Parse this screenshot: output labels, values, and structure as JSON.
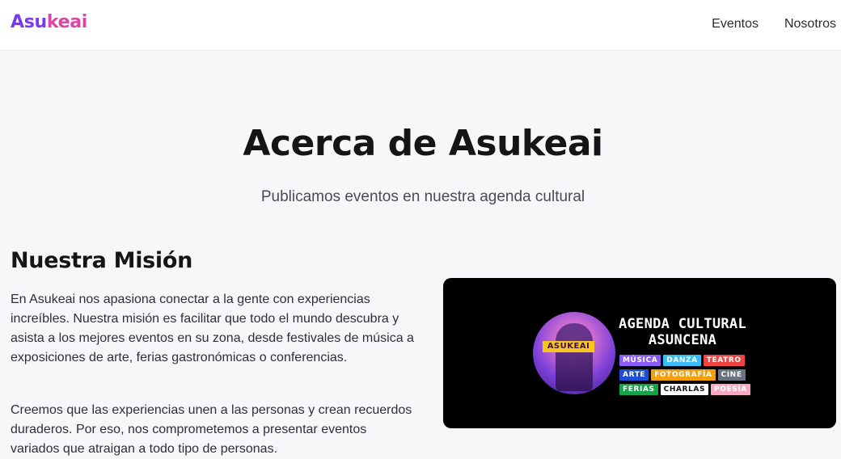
{
  "header": {
    "brand_part1": "Asu",
    "brand_part2": "keai",
    "nav": [
      {
        "label": "Eventos"
      },
      {
        "label": "Nosotros"
      }
    ]
  },
  "hero": {
    "title": "Acerca de Asukeai",
    "subtitle": "Publicamos eventos en nuestra agenda cultural"
  },
  "mission": {
    "title": "Nuestra Misión",
    "paragraph1": "En Asukeai nos apasiona conectar a la gente con experiencias increíbles. Nuestra misión es facilitar que todo el mundo descubra y asista a los mejores eventos en su zona, desde festivales de música a exposiciones de arte, ferias gastronómicas o conferencias.",
    "paragraph2": "Creemos que las experiencias unen a las personas y crean recuerdos duraderos. Por eso, nos comprometemos a presentar eventos variados que atraigan a todo tipo de personas."
  },
  "banner": {
    "logo_tag": "ASUKEAI",
    "title": "AGENDA CULTURAL ASUNCENA",
    "chips": [
      {
        "label": "MÚSICA",
        "bg": "#8b5cf6",
        "fg": "#ffffff"
      },
      {
        "label": "DANZA",
        "bg": "#38bdf8",
        "fg": "#ffffff"
      },
      {
        "label": "TEATRO",
        "bg": "#ef4444",
        "fg": "#ffffff"
      },
      {
        "label": "ARTE",
        "bg": "#1d4ed8",
        "fg": "#ffffff"
      },
      {
        "label": "FOTOGRAFÍA",
        "bg": "#f59e0b",
        "fg": "#ffffff"
      },
      {
        "label": "CINE",
        "bg": "#6b7280",
        "fg": "#ffffff"
      },
      {
        "label": "FERIAS",
        "bg": "#16a34a",
        "fg": "#ffffff"
      },
      {
        "label": "CHARLAS",
        "bg": "#ffffff",
        "fg": "#111111"
      },
      {
        "label": "POESÍA",
        "bg": "#f9a8c4",
        "fg": "#ffffff"
      }
    ]
  },
  "colors": {
    "brand_purple": "#7c3aed",
    "brand_pink": "#d946a8",
    "page_bg": "#f7f7f9",
    "banner_bg": "#000000"
  }
}
